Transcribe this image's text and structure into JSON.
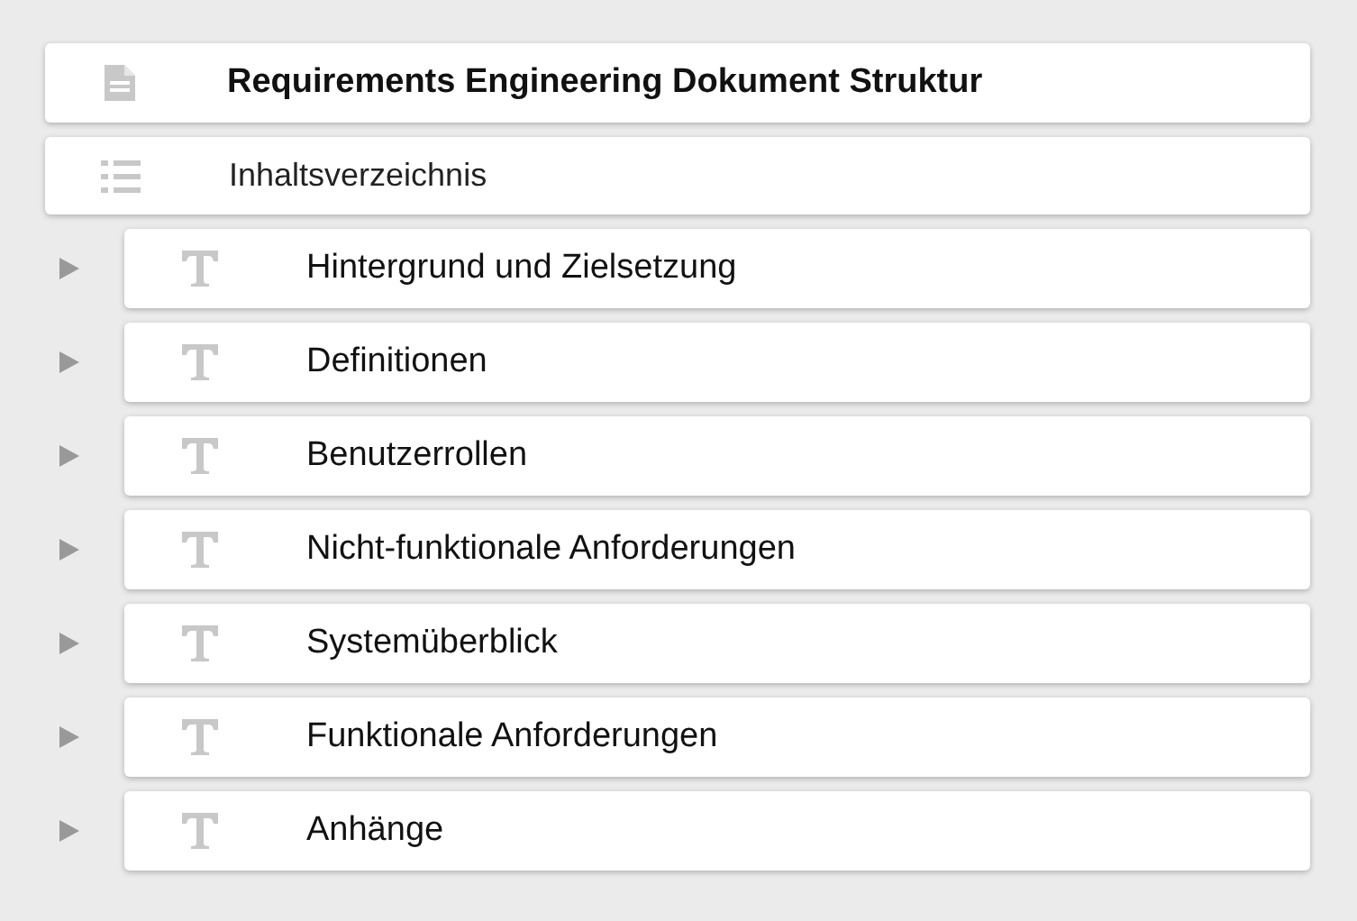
{
  "document": {
    "title": "Requirements Engineering Dokument Struktur"
  },
  "toc": {
    "label": "Inhaltsverzeichnis"
  },
  "sections": [
    {
      "label": "Hintergrund und Zielsetzung",
      "expanded": false
    },
    {
      "label": "Definitionen",
      "expanded": false
    },
    {
      "label": "Benutzerrollen",
      "expanded": false
    },
    {
      "label": "Nicht-funktionale Anforderungen",
      "expanded": false
    },
    {
      "label": "Systemüberblick",
      "expanded": false
    },
    {
      "label": "Funktionale Anforderungen",
      "expanded": false
    },
    {
      "label": "Anhänge",
      "expanded": false
    }
  ]
}
